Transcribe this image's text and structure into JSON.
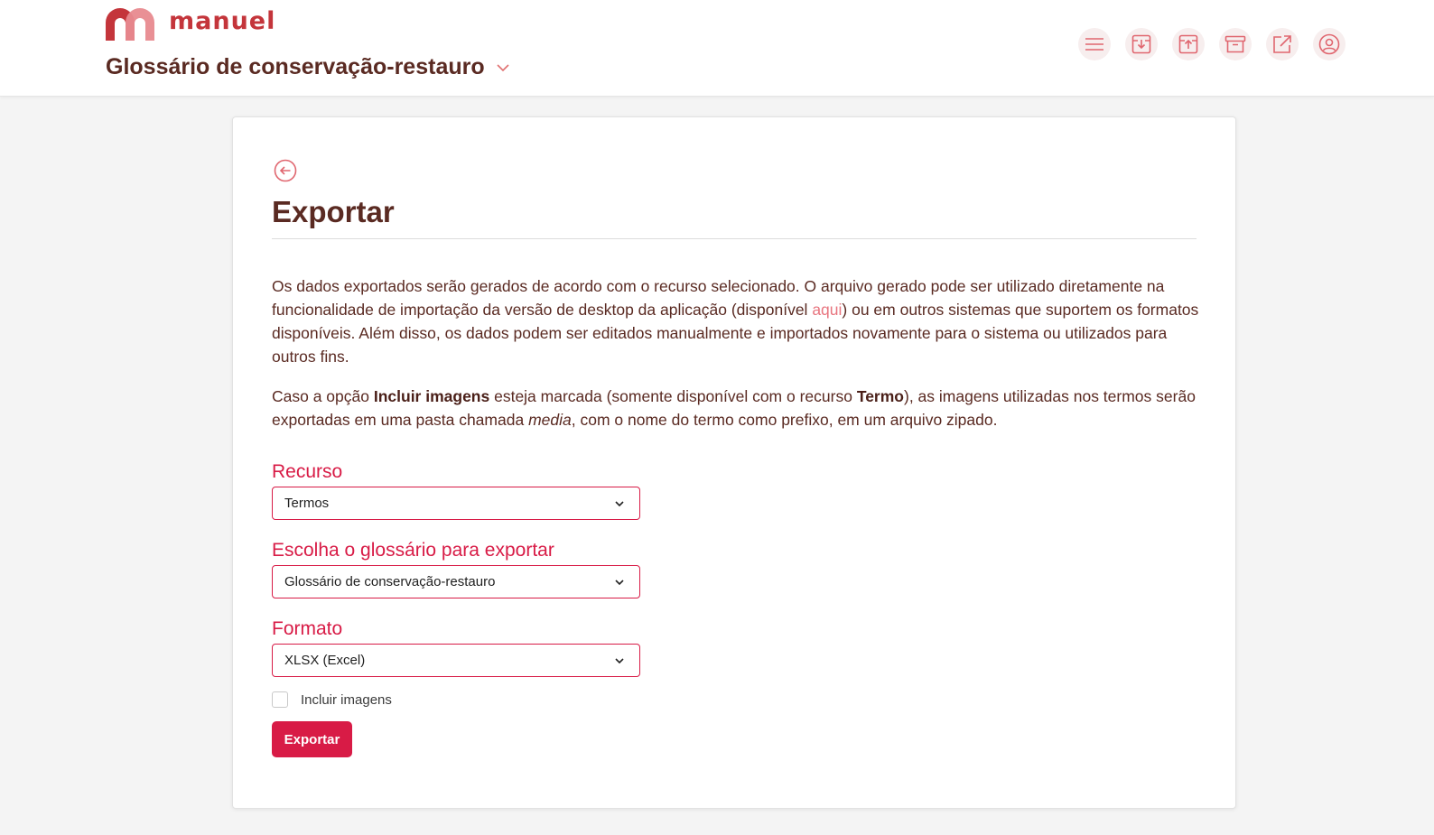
{
  "app": {
    "logo_text": "manuel",
    "glossary_title": "Glossário de conservação-restauro"
  },
  "colors": {
    "brand": "#c4353b",
    "accent": "#d81b46",
    "text": "#5a2a22",
    "link": "#e8757f"
  },
  "toolbar": {
    "icons": [
      "menu-icon",
      "import-icon",
      "export-icon",
      "archive-icon",
      "external-link-icon",
      "user-icon"
    ]
  },
  "page": {
    "title": "Exportar",
    "intro_p1_before_link": "Os dados exportados serão gerados de acordo com o recurso selecionado. O arquivo gerado pode ser utilizado diretamente na funcionalidade de importação da versão de desktop da aplicação (disponível ",
    "intro_p1_link": "aqui",
    "intro_p1_after_link": ") ou em outros sistemas que suportem os formatos disponíveis. Além disso, os dados podem ser editados manualmente e importados novamente para o sistema ou utilizados para outros fins.",
    "intro_p2_a": "Caso a opção ",
    "intro_p2_bold1": "Incluir imagens",
    "intro_p2_b": " esteja marcada (somente disponível com o recurso ",
    "intro_p2_bold2": "Termo",
    "intro_p2_c": "), as imagens utilizadas nos termos serão exportadas em uma pasta chamada ",
    "intro_p2_italic": "media",
    "intro_p2_d": ", com o nome do termo como prefixo, em um arquivo zipado."
  },
  "form": {
    "resource_label": "Recurso",
    "resource_value": "Termos",
    "glossary_label": "Escolha o glossário para exportar",
    "glossary_value": "Glossário de conservação-restauro",
    "format_label": "Formato",
    "format_value": "XLSX (Excel)",
    "include_images_label": "Incluir imagens",
    "include_images_checked": false,
    "export_button": "Exportar"
  }
}
